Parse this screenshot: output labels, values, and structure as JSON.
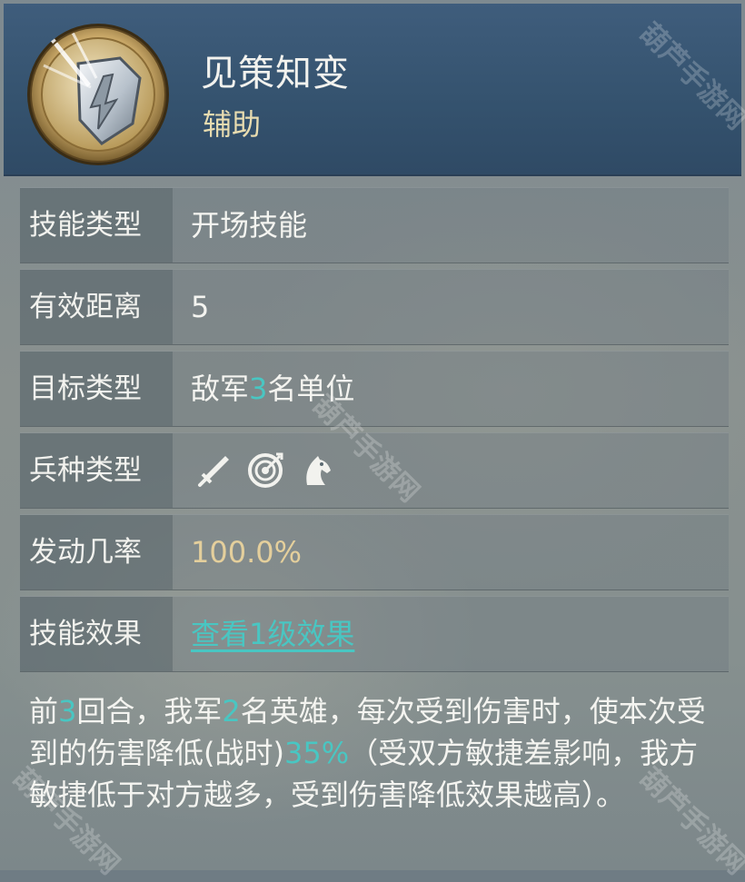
{
  "skill": {
    "name": "见策知变",
    "category": "辅助",
    "icon": "shield-skill-icon"
  },
  "rows": [
    {
      "label": "技能类型",
      "value": "开场技能"
    },
    {
      "label": "有效距离",
      "value": "5"
    },
    {
      "label": "目标类型",
      "value_prefix": "敌军",
      "value_highlight": "3",
      "value_suffix": "名单位"
    },
    {
      "label": "兵种类型",
      "troop_icons": [
        "sword-icon",
        "target-icon",
        "horse-icon"
      ]
    },
    {
      "label": "发动几率",
      "value": "100.0%"
    },
    {
      "label": "技能效果",
      "link": "查看1级效果"
    }
  ],
  "description": {
    "p1": "前",
    "n1": "3",
    "p2": "回合，我军",
    "n2": "2",
    "p3": "名英雄，每次受到伤害时，使本次受到的伤害降低(战时)",
    "n3": "35%",
    "p4": "（受双方敏捷差影响，我方敏捷低于对方越多，受到伤害降低效果越高）。"
  },
  "watermark": "葫芦手游网",
  "colors": {
    "header_bg": "#35536f",
    "highlight": "#49c6c2",
    "rate": "#e4cf9c",
    "category": "#e8dcb0"
  }
}
